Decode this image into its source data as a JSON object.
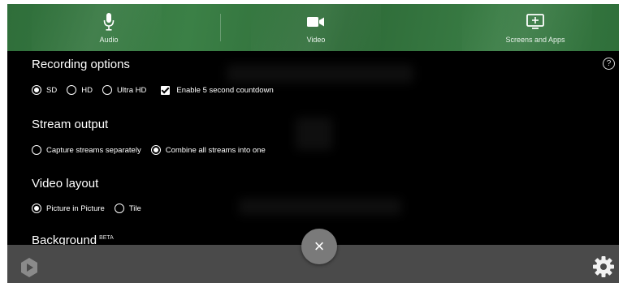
{
  "tabs": [
    {
      "label": "Audio",
      "icon": "microphone-icon"
    },
    {
      "label": "Video",
      "icon": "video-camera-icon"
    },
    {
      "label": "Screens and Apps",
      "icon": "screen-share-icon"
    }
  ],
  "help": {
    "glyph": "?"
  },
  "recording_options": {
    "title": "Recording options",
    "quality": {
      "options": [
        "SD",
        "HD",
        "Ultra HD"
      ],
      "selected": "SD"
    },
    "countdown": {
      "label": "Enable 5 second countdown",
      "checked": true
    }
  },
  "stream_output": {
    "title": "Stream output",
    "options": [
      "Capture streams separately",
      "Combine all streams into one"
    ],
    "selected": "Combine all streams into one"
  },
  "video_layout": {
    "title": "Video layout",
    "options": [
      "Picture in Picture",
      "Tile"
    ],
    "selected": "Picture in Picture"
  },
  "background": {
    "title": "Background",
    "badge": "BETA"
  },
  "close_button": {
    "glyph": "×"
  },
  "colors": {
    "accent_green": "#3b8046",
    "bottom_bar": "#4a4a4a",
    "fab": "#7a7a7a"
  }
}
